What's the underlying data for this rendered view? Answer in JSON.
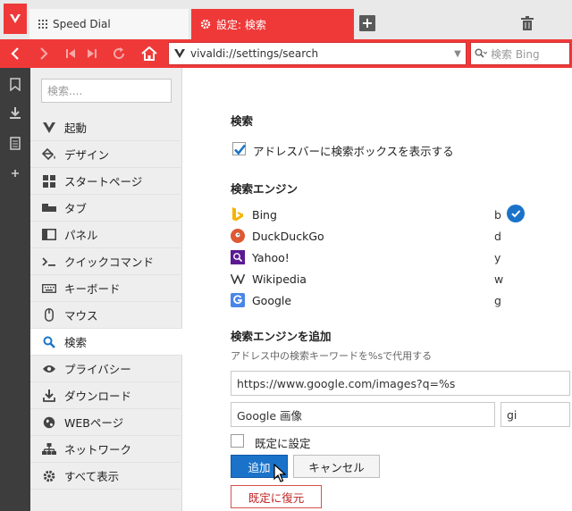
{
  "tabs": [
    {
      "label": "Speed Dial",
      "icon": "grid-icon",
      "active": false
    },
    {
      "label": "設定: 検索",
      "icon": "gear-icon",
      "active": true
    }
  ],
  "address": {
    "url": "vivaldi://settings/search",
    "search_placeholder": "検索 Bing"
  },
  "sidebar": {
    "search_placeholder": "検索....",
    "items": [
      {
        "label": "起動",
        "icon": "vivaldi-icon"
      },
      {
        "label": "デザイン",
        "icon": "paint-bucket-icon"
      },
      {
        "label": "スタートページ",
        "icon": "tiles-icon"
      },
      {
        "label": "タブ",
        "icon": "tab-icon"
      },
      {
        "label": "パネル",
        "icon": "panel-icon"
      },
      {
        "label": "クイックコマンド",
        "icon": "quick-command-icon"
      },
      {
        "label": "キーボード",
        "icon": "keyboard-icon"
      },
      {
        "label": "マウス",
        "icon": "mouse-icon"
      },
      {
        "label": "検索",
        "icon": "search-icon",
        "active": true
      },
      {
        "label": "プライバシー",
        "icon": "eye-icon"
      },
      {
        "label": "ダウンロード",
        "icon": "download-icon"
      },
      {
        "label": "WEBページ",
        "icon": "globe-icon"
      },
      {
        "label": "ネットワーク",
        "icon": "network-icon"
      },
      {
        "label": "すべて表示",
        "icon": "gear-icon"
      }
    ]
  },
  "content": {
    "search_heading": "検索",
    "show_search_box_label": "アドレスバーに検索ボックスを表示する",
    "show_search_box_checked": true,
    "engines_heading": "検索エンジン",
    "engines": [
      {
        "name": "Bing",
        "key": "b",
        "default": true,
        "color": "#f4b400"
      },
      {
        "name": "DuckDuckGo",
        "key": "d",
        "default": false,
        "color": "#de5833"
      },
      {
        "name": "Yahoo!",
        "key": "y",
        "default": false,
        "color": "#6a1b9a"
      },
      {
        "name": "Wikipedia",
        "key": "w",
        "default": false,
        "color": "#333333"
      },
      {
        "name": "Google",
        "key": "g",
        "default": false,
        "color": "#4a86e8"
      }
    ],
    "add_heading": "検索エンジンを追加",
    "add_hint": "アドレス中の検索キーワードを%sで代用する",
    "url_value": "https://www.google.com/images?q=%s",
    "name_value": "Google 画像",
    "key_value": "gi",
    "set_default_label": "既定に設定",
    "set_default_checked": false,
    "add_button": "追加",
    "cancel_button": "キャンセル",
    "reset_button": "既定に復元"
  },
  "colors": {
    "accent": "#ef3939",
    "primary": "#1a73c9"
  }
}
